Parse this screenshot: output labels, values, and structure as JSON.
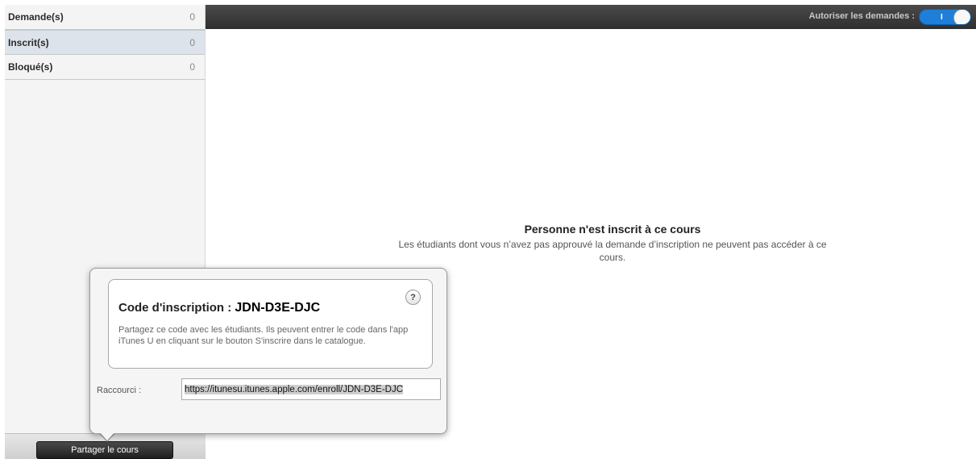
{
  "sidebar": {
    "items": [
      {
        "label": "Demande(s)",
        "count": "0"
      },
      {
        "label": "Inscrit(s)",
        "count": "0"
      },
      {
        "label": "Bloqué(s)",
        "count": "0"
      }
    ],
    "share_button": "Partager le cours"
  },
  "topbar": {
    "allow_label": "Autoriser les demandes :",
    "toggle_on_label": "I"
  },
  "empty_state": {
    "title": "Personne n'est inscrit à ce cours",
    "description": "Les étudiants dont vous n’avez pas approuvé la demande d’inscription ne peuvent pas accéder à ce cours."
  },
  "popover": {
    "help_label": "?",
    "code_label": "Code d'inscription :",
    "code_value": "JDN-D3E-DJC",
    "code_description": "Partagez ce code avec les étudiants. Ils peuvent entrer le code dans l'app iTunes U en cliquant sur le bouton S'inscrire dans le catalogue.",
    "shortcut_label": "Raccourci :",
    "shortcut_url": "https://itunesu.itunes.apple.com/enroll/JDN-D3E-DJC"
  },
  "colors": {
    "topbar": "#3b3b3b",
    "toggle_on": "#1f7ed8",
    "selected_row": "#dde3ea"
  }
}
